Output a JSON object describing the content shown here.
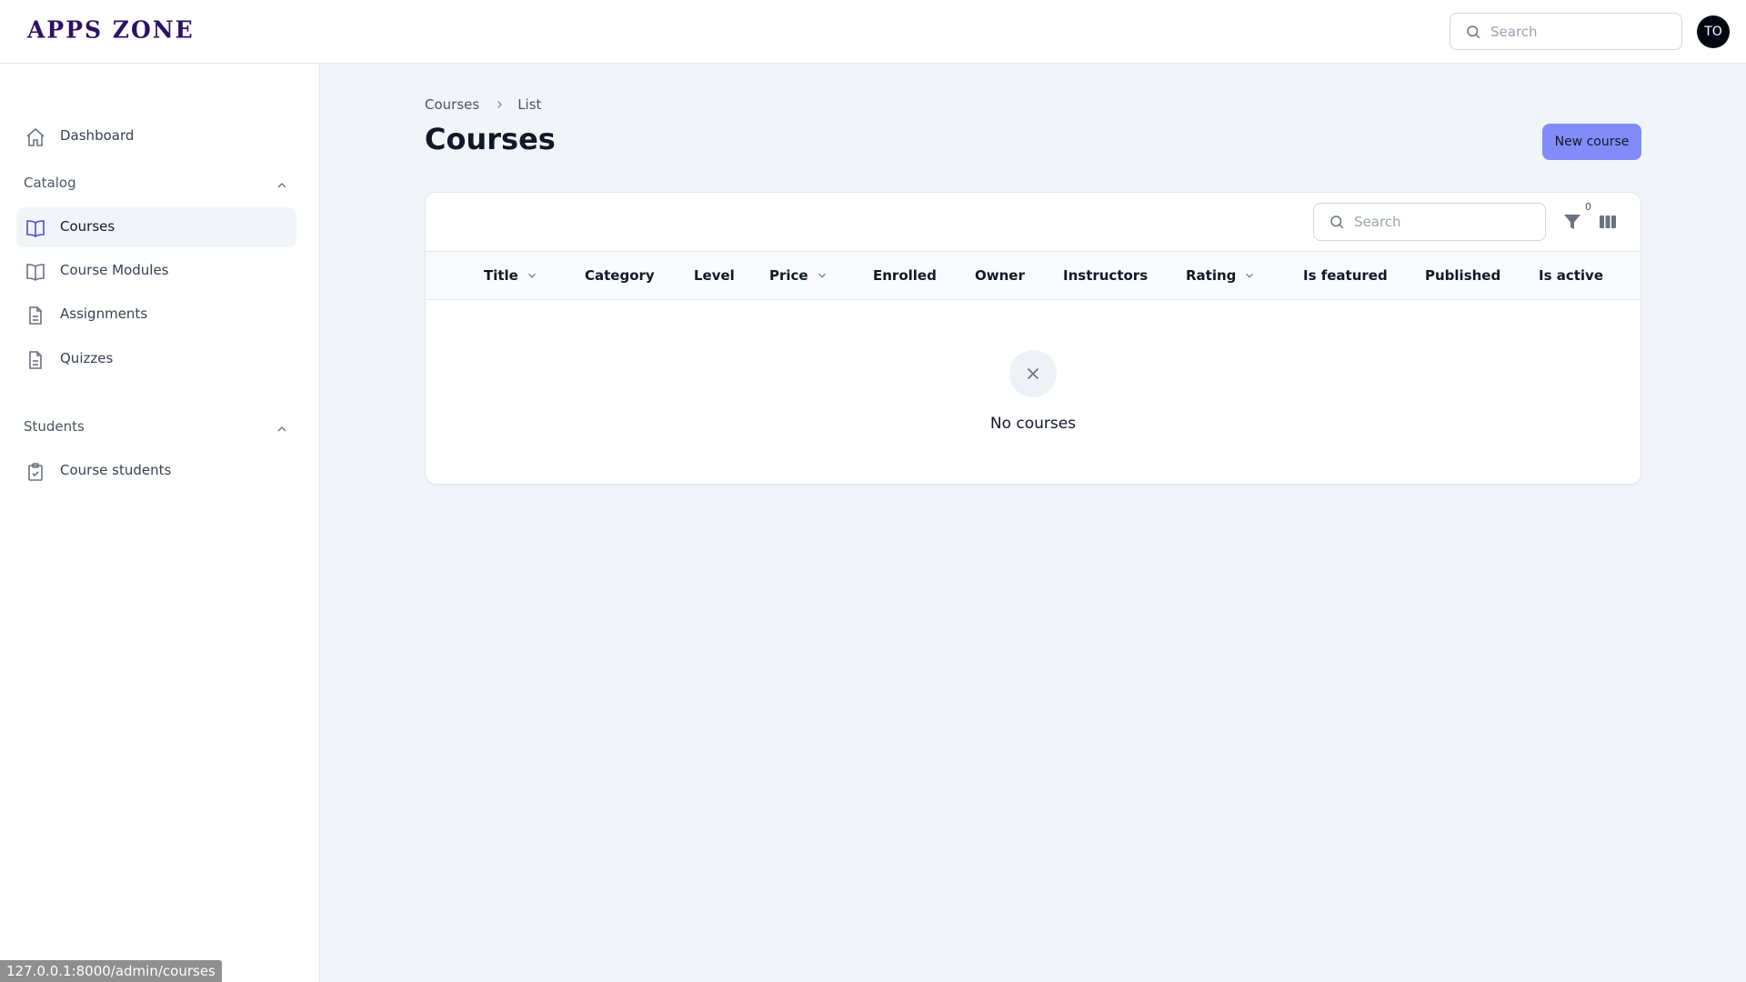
{
  "app": {
    "logo": "APPS ZONE"
  },
  "topbar": {
    "search_placeholder": "Search",
    "avatar_initials": "TO"
  },
  "sidebar": {
    "dashboard_label": "Dashboard",
    "catalog_label": "Catalog",
    "catalog_items": [
      "Courses",
      "Course Modules",
      "Assignments",
      "Quizzes"
    ],
    "students_label": "Students",
    "students_items": [
      "Course students"
    ]
  },
  "breadcrumb": [
    "Courses",
    "List"
  ],
  "page": {
    "title": "Courses",
    "new_button": "New course"
  },
  "table": {
    "search_placeholder": "Search",
    "filter_count": "0",
    "columns": [
      "Title",
      "Category",
      "Level",
      "Price",
      "Enrolled",
      "Owner",
      "Instructors",
      "Rating",
      "Is featured",
      "Published",
      "Is active"
    ],
    "empty_text": "No courses"
  },
  "status_bar": {
    "url": "127.0.0.1:8000/admin/courses"
  },
  "colors": {
    "accent": "#818cf8",
    "logo": "#2e1065",
    "active_bg": "#f1f5f9"
  },
  "icons": [
    "search-icon",
    "home-icon",
    "book-open-icon",
    "document-icon",
    "clipboard-check-icon",
    "chevron-up-icon",
    "chevron-down-icon",
    "chevron-right-icon",
    "funnel-icon",
    "columns-icon",
    "x-mark-icon"
  ]
}
